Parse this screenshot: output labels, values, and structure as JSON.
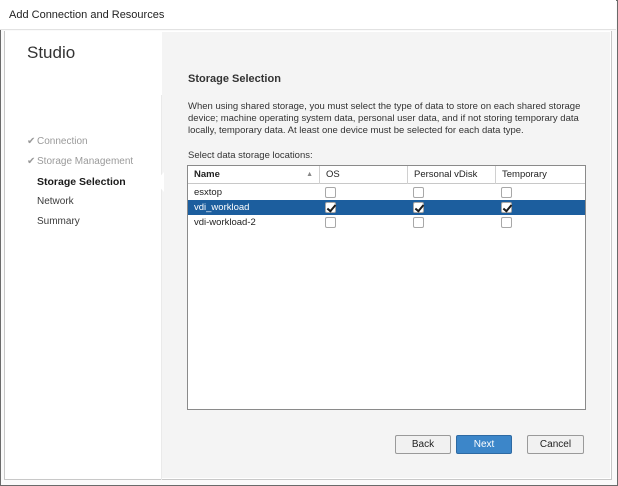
{
  "window": {
    "title": "Add Connection and Resources"
  },
  "sidebar": {
    "app_title": "Studio",
    "steps": [
      {
        "label": "Connection",
        "state": "done",
        "check": "✔"
      },
      {
        "label": "Storage Management",
        "state": "done",
        "check": "✔"
      },
      {
        "label": "Storage Selection",
        "state": "active"
      },
      {
        "label": "Network",
        "state": "pending"
      },
      {
        "label": "Summary",
        "state": "pending"
      }
    ]
  },
  "main": {
    "title": "Storage Selection",
    "description": "When using shared storage, you must select the type of data to store on each shared storage device; machine operating system data, personal user data, and if not storing temporary data locally, temporary data. At least one device must be selected for each data type.",
    "select_label": "Select data storage locations:",
    "grid": {
      "columns": [
        "Name",
        "OS",
        "Personal vDisk",
        "Temporary"
      ],
      "rows": [
        {
          "name": "esxtop",
          "os": false,
          "personal_vdisk": false,
          "temporary": false,
          "selected": false
        },
        {
          "name": "vdi_workload",
          "os": true,
          "personal_vdisk": true,
          "temporary": true,
          "selected": true
        },
        {
          "name": "vdi-workload-2",
          "os": false,
          "personal_vdisk": false,
          "temporary": false,
          "selected": false
        }
      ]
    }
  },
  "buttons": {
    "back": "Back",
    "next": "Next",
    "cancel": "Cancel"
  },
  "colors": {
    "selected_row": "#1c5e9e",
    "primary_button": "#3c86c9"
  }
}
